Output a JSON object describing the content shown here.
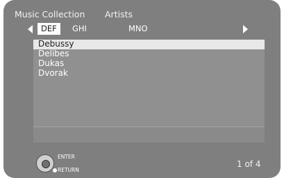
{
  "header": {
    "title": "Music Collection",
    "category": "Artists"
  },
  "tabs": [
    {
      "label": "DEF",
      "selected": true
    },
    {
      "label": "GHI",
      "selected": false
    },
    {
      "label": "MNO",
      "selected": false
    }
  ],
  "list": {
    "items": [
      {
        "label": "Debussy",
        "selected": true
      },
      {
        "label": "Delibes",
        "selected": false
      },
      {
        "label": "Dukas",
        "selected": false
      },
      {
        "label": "Dvorak",
        "selected": false
      }
    ]
  },
  "footer": {
    "enter_label": "ENTER",
    "return_label": "RETURN",
    "page_indicator": "1 of 4"
  },
  "icons": {
    "prev": "triangle-left-icon",
    "next": "triangle-right-icon",
    "remote": "dpad-icon",
    "return": "dot-icon"
  },
  "colors": {
    "background": "#7f7f7f",
    "list_panel": "#909090",
    "selection": "#e8e8e8",
    "text": "#ffffff"
  }
}
